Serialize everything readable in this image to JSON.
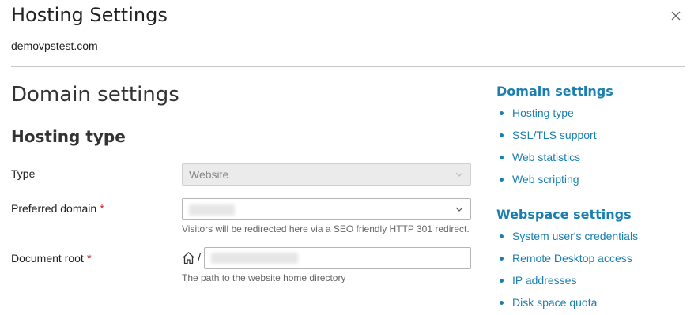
{
  "dialog": {
    "title": "Hosting Settings",
    "subtitle": "demovpstest.com"
  },
  "main": {
    "section_title": "Domain settings",
    "subsection_title": "Hosting type",
    "fields": {
      "type": {
        "label": "Type",
        "value": "Website"
      },
      "preferred_domain": {
        "label": "Preferred domain",
        "required_mark": "*",
        "hint": "Visitors will be redirected here via a SEO friendly HTTP 301 redirect."
      },
      "document_root": {
        "label": "Document root",
        "required_mark": "*",
        "slash": "/",
        "hint": "The path to the website home directory"
      }
    }
  },
  "sidebar": {
    "domain_heading": "Domain settings",
    "domain_items": [
      "Hosting type",
      "SSL/TLS support",
      "Web statistics",
      "Web scripting"
    ],
    "webspace_heading": "Webspace settings",
    "webspace_items": [
      "System user's credentials",
      "Remote Desktop access",
      "IP addresses",
      "Disk space quota"
    ]
  },
  "colors": {
    "link": "#1a7fb0",
    "required": "#d02d2d",
    "divider": "#c9c9c9"
  },
  "icons": {
    "close": "close-icon",
    "chevron": "chevron-down-icon",
    "home": "home-icon"
  }
}
